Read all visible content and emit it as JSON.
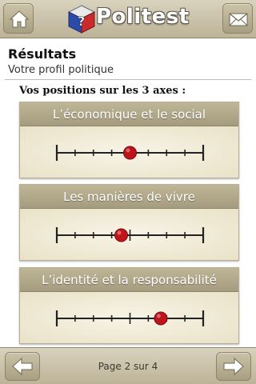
{
  "app": {
    "name": "Politest",
    "icons": {
      "home": "home-icon",
      "mail": "mail-icon",
      "logo": "cube-question-icon"
    }
  },
  "header": {
    "title": "Résultats",
    "subtitle": "Votre profil politique"
  },
  "section": {
    "heading": "Vos positions sur les 3 axes :"
  },
  "axes": [
    {
      "label": "L’économique et le social",
      "position": 0.5
    },
    {
      "label": "Les manières de vivre",
      "position": 0.44
    },
    {
      "label": "L’identité et la responsabilité",
      "position": 0.71
    }
  ],
  "footer": {
    "page_indicator": "Page 2 sur 4",
    "icons": {
      "prev": "arrow-left-icon",
      "next": "arrow-right-icon"
    }
  },
  "colors": {
    "marker": "#c0141c",
    "bar": "#c6bea3",
    "card": "#f1ecd9"
  }
}
